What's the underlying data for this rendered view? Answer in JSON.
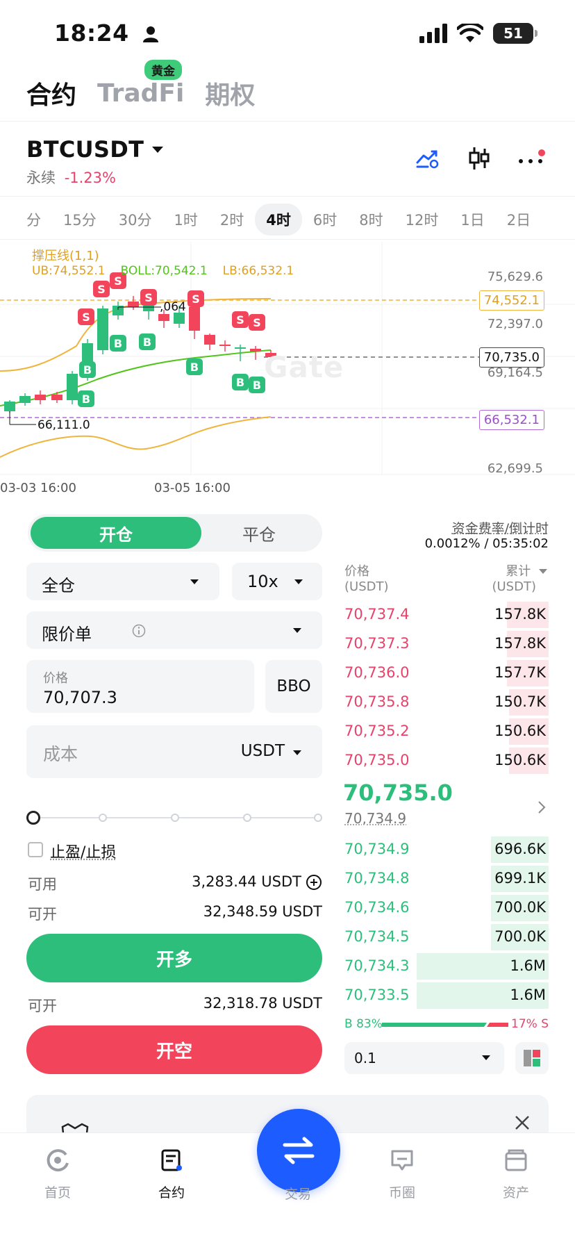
{
  "status_bar": {
    "time": "18:24",
    "battery": "51"
  },
  "top_tabs": [
    {
      "label": "合约",
      "active": true
    },
    {
      "label": "TradFi",
      "badge": "黄金",
      "active": false
    },
    {
      "label": "期权",
      "active": false
    }
  ],
  "header": {
    "symbol": "BTCUSDT",
    "contract_type": "永续",
    "change": "-1.23%"
  },
  "timeframes": [
    "分",
    "15分",
    "30分",
    "1时",
    "2时",
    "4时",
    "6时",
    "8时",
    "12时",
    "1日",
    "2日"
  ],
  "timeframe_active": "4时",
  "chart": {
    "indicator_title": "撑压线(1,1)",
    "ub_label": "UB:74,552.1",
    "boll_label": "BOLL:70,542.1",
    "lb_label": "LB:66,532.1",
    "y_ticks": [
      "75,629.6",
      "72,397.0",
      "69,164.5",
      "62,699.5"
    ],
    "ub_tag": "74,552.1",
    "last_tag": "70,735.0",
    "lb_tag": "66,532.1",
    "high_annotation": ",064",
    "low_annotation": "66,111.0",
    "x_ticks": [
      "03-03 16:00",
      "03-05 16:00"
    ],
    "watermark": "Gate",
    "colors": {
      "up": "#2dbe7c",
      "down": "#f2455c",
      "ub": "#f0b43c",
      "boll": "#52c41a",
      "lb_line": "#b06ad8"
    },
    "signal_sell": "S",
    "signal_buy": "B"
  },
  "order_form": {
    "open_tab": "开仓",
    "close_tab": "平仓",
    "margin_mode": "全仓",
    "leverage": "10x",
    "order_type": "限价单",
    "price_label": "价格",
    "price_value": "70,707.3",
    "bbo": "BBO",
    "cost_placeholder": "成本",
    "cost_unit": "USDT",
    "tpsl_label": "止盈/止损",
    "available_label": "可用",
    "available_value": "3,283.44 USDT",
    "can_open_label": "可开",
    "can_open_long": "32,348.59 USDT",
    "long_button": "开多",
    "can_open_label2": "可开",
    "can_open_short": "32,318.78 USDT",
    "short_button": "开空"
  },
  "order_book": {
    "funding_title": "资金费率/倒计时",
    "funding_value": "0.0012% / 05:35:02",
    "price_header": "价格",
    "price_unit": "(USDT)",
    "qty_header": "累计",
    "qty_unit": "(USDT)",
    "asks": [
      {
        "price": "70,737.4",
        "qty": "157.8K"
      },
      {
        "price": "70,737.3",
        "qty": "157.8K"
      },
      {
        "price": "70,736.0",
        "qty": "157.7K"
      },
      {
        "price": "70,735.8",
        "qty": "150.7K"
      },
      {
        "price": "70,735.2",
        "qty": "150.6K"
      },
      {
        "price": "70,735.0",
        "qty": "150.6K"
      }
    ],
    "last_price": "70,735.0",
    "mark_price": "70,734.9",
    "bids": [
      {
        "price": "70,734.9",
        "qty": "696.6K"
      },
      {
        "price": "70,734.8",
        "qty": "699.1K"
      },
      {
        "price": "70,734.6",
        "qty": "700.0K"
      },
      {
        "price": "70,734.5",
        "qty": "700.0K"
      },
      {
        "price": "70,734.3",
        "qty": "1.6M"
      },
      {
        "price": "70,733.5",
        "qty": "1.6M"
      }
    ],
    "buy_ratio": "B 83%",
    "sell_ratio": "17% S",
    "buy_ratio_value": 0.83,
    "depth_step": "0.1"
  },
  "bottom_nav": [
    {
      "label": "首页",
      "icon": "home-icon"
    },
    {
      "label": "合约",
      "icon": "futures-icon",
      "active": true
    },
    {
      "label": "交易",
      "icon": "swap-icon"
    },
    {
      "label": "币圈",
      "icon": "community-icon"
    },
    {
      "label": "资产",
      "icon": "wallet-icon"
    }
  ]
}
